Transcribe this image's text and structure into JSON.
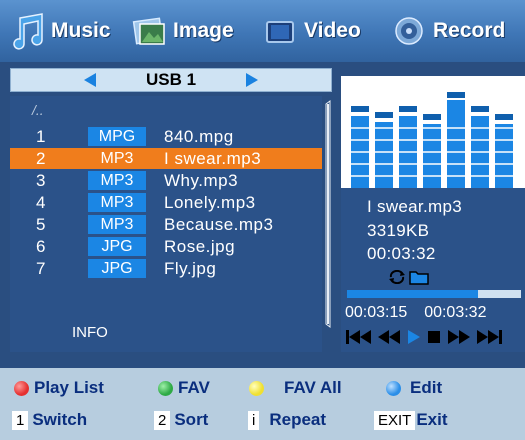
{
  "tabs": [
    {
      "label": "Music",
      "icon": "music-note-icon",
      "active": true
    },
    {
      "label": "Image",
      "icon": "image-icon",
      "active": false
    },
    {
      "label": "Video",
      "icon": "video-icon",
      "active": false
    },
    {
      "label": "Record",
      "icon": "record-icon",
      "active": false
    }
  ],
  "source": {
    "label": "USB 1"
  },
  "file_list": {
    "parent": "/..",
    "rows": [
      {
        "num": "1",
        "type": "MPG",
        "name": "840.mpg",
        "selected": false
      },
      {
        "num": "2",
        "type": "MP3",
        "name": "I swear.mp3",
        "selected": true
      },
      {
        "num": "3",
        "type": "MP3",
        "name": "Why.mp3",
        "selected": false
      },
      {
        "num": "4",
        "type": "MP3",
        "name": "Lonely.mp3",
        "selected": false
      },
      {
        "num": "5",
        "type": "MP3",
        "name": "Because.mp3",
        "selected": false
      },
      {
        "num": "6",
        "type": "JPG",
        "name": "Rose.jpg",
        "selected": false
      },
      {
        "num": "7",
        "type": "JPG",
        "name": "Fly.jpg",
        "selected": false
      }
    ],
    "info_label": "INFO"
  },
  "now_playing": {
    "file_name": "I swear.mp3",
    "size": "3319KB",
    "duration": "00:03:32",
    "elapsed": "00:03:15",
    "total": "00:03:32",
    "progress": 0.75
  },
  "help": {
    "play_list": "Play List",
    "fav": "FAV",
    "fav_all": "FAV All",
    "edit": "Edit",
    "switch_key": "1",
    "switch": "Switch",
    "sort_key": "2",
    "sort": "Sort",
    "repeat_key": "i",
    "repeat": "Repeat",
    "exit_key": "EXIT",
    "exit": "Exit"
  },
  "colors": {
    "accent_blue": "#1b86e4",
    "selected_orange": "#f07d1c",
    "red_key": "#e53030",
    "green_key": "#2eaa45",
    "yellow_key": "#f0e030",
    "blue_key": "#2a8ee8"
  }
}
